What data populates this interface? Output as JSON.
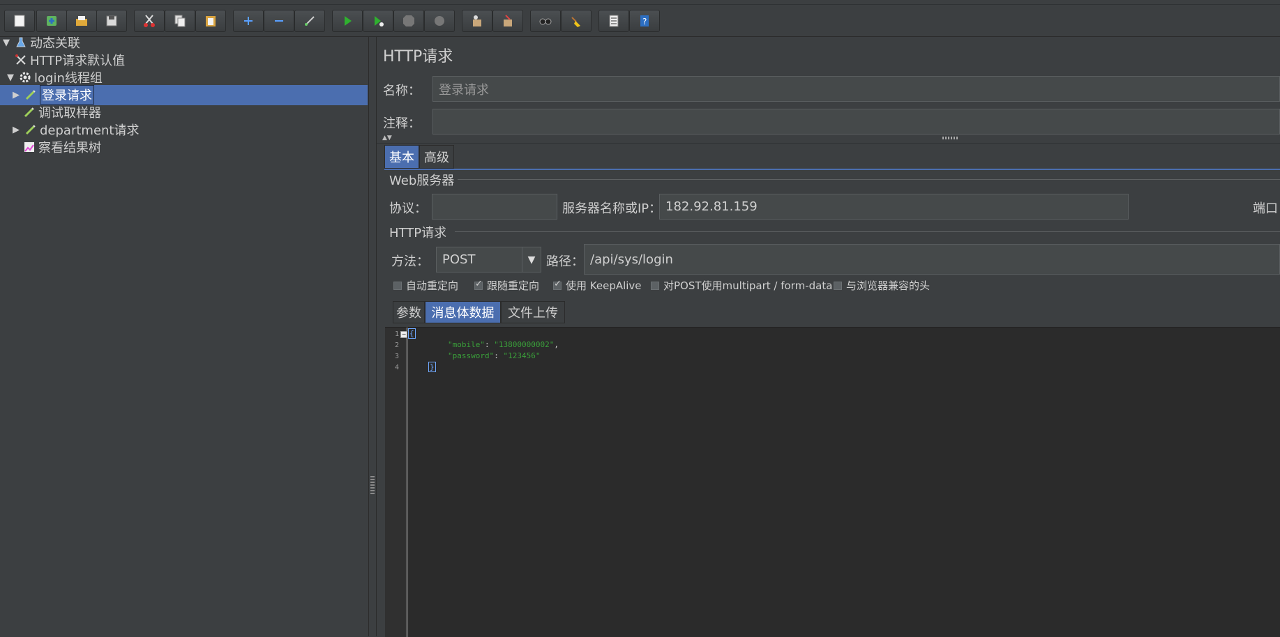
{
  "toolbar": {
    "buttons": [
      {
        "name": "new-icon"
      },
      {
        "name": "templates-icon"
      },
      {
        "name": "open-icon"
      },
      {
        "name": "save-icon"
      },
      {
        "name": "cut-icon"
      },
      {
        "name": "copy-icon"
      },
      {
        "name": "paste-icon"
      },
      {
        "name": "expand-icon"
      },
      {
        "name": "collapse-icon"
      },
      {
        "name": "toggle-icon"
      },
      {
        "name": "start-icon"
      },
      {
        "name": "start-no-pause-icon"
      },
      {
        "name": "stop-icon"
      },
      {
        "name": "shutdown-icon"
      },
      {
        "name": "remote-start-icon"
      },
      {
        "name": "remote-stop-icon"
      },
      {
        "name": "search-icon"
      },
      {
        "name": "clear-icon"
      },
      {
        "name": "function-helper-icon"
      },
      {
        "name": "help-icon"
      }
    ]
  },
  "tree": {
    "items": [
      {
        "label": "动态关联",
        "expanded": "▼",
        "icon": "test-plan-icon"
      },
      {
        "label": "HTTP请求默认值",
        "expanded": "",
        "icon": "config-element-icon"
      },
      {
        "label": "login线程组",
        "expanded": "▼",
        "icon": "thread-group-icon"
      },
      {
        "label": "登录请求",
        "expanded": "▶",
        "icon": "sampler-icon",
        "selected": true
      },
      {
        "label": "调试取样器",
        "expanded": "",
        "icon": "sampler-icon"
      },
      {
        "label": "department请求",
        "expanded": "▶",
        "icon": "sampler-icon"
      },
      {
        "label": "察看结果树",
        "expanded": "",
        "icon": "listener-icon"
      }
    ]
  },
  "panel": {
    "title": "HTTP请求",
    "name_label": "名称：",
    "name_value": "登录请求",
    "comment_label": "注释：",
    "comment_value": "",
    "tabs": [
      {
        "label": "基本",
        "active": true
      },
      {
        "label": "高级",
        "active": false
      }
    ],
    "web_server": {
      "section_title": "Web服务器",
      "protocol_label": "协议：",
      "protocol_value": "",
      "server_label": "服务器名称或IP：",
      "server_value": "182.92.81.159",
      "port_label": "端口"
    },
    "http_request": {
      "section_title": "HTTP请求",
      "method_label": "方法：",
      "method_value": "POST",
      "path_label": "路径：",
      "path_value": "/api/sys/login"
    },
    "options": [
      {
        "label": "自动重定向",
        "checked": false
      },
      {
        "label": "跟随重定向",
        "checked": true
      },
      {
        "label": "使用 KeepAlive",
        "checked": true
      },
      {
        "label": "对POST使用multipart / form-data",
        "checked": false
      },
      {
        "label": "与浏览器兼容的头",
        "checked": false
      }
    ],
    "body_tabs": [
      {
        "label": "参数",
        "active": false
      },
      {
        "label": "消息体数据",
        "active": true
      },
      {
        "label": "文件上传",
        "active": false
      }
    ],
    "body": {
      "line_numbers": [
        "1",
        "2",
        "3",
        "4"
      ],
      "open_brace": "{",
      "mobile_key": "\"mobile\"",
      "mobile_value": "\"13800000002\"",
      "password_key": "\"password\"",
      "password_value": "\"123456\"",
      "close_brace": "}"
    }
  }
}
